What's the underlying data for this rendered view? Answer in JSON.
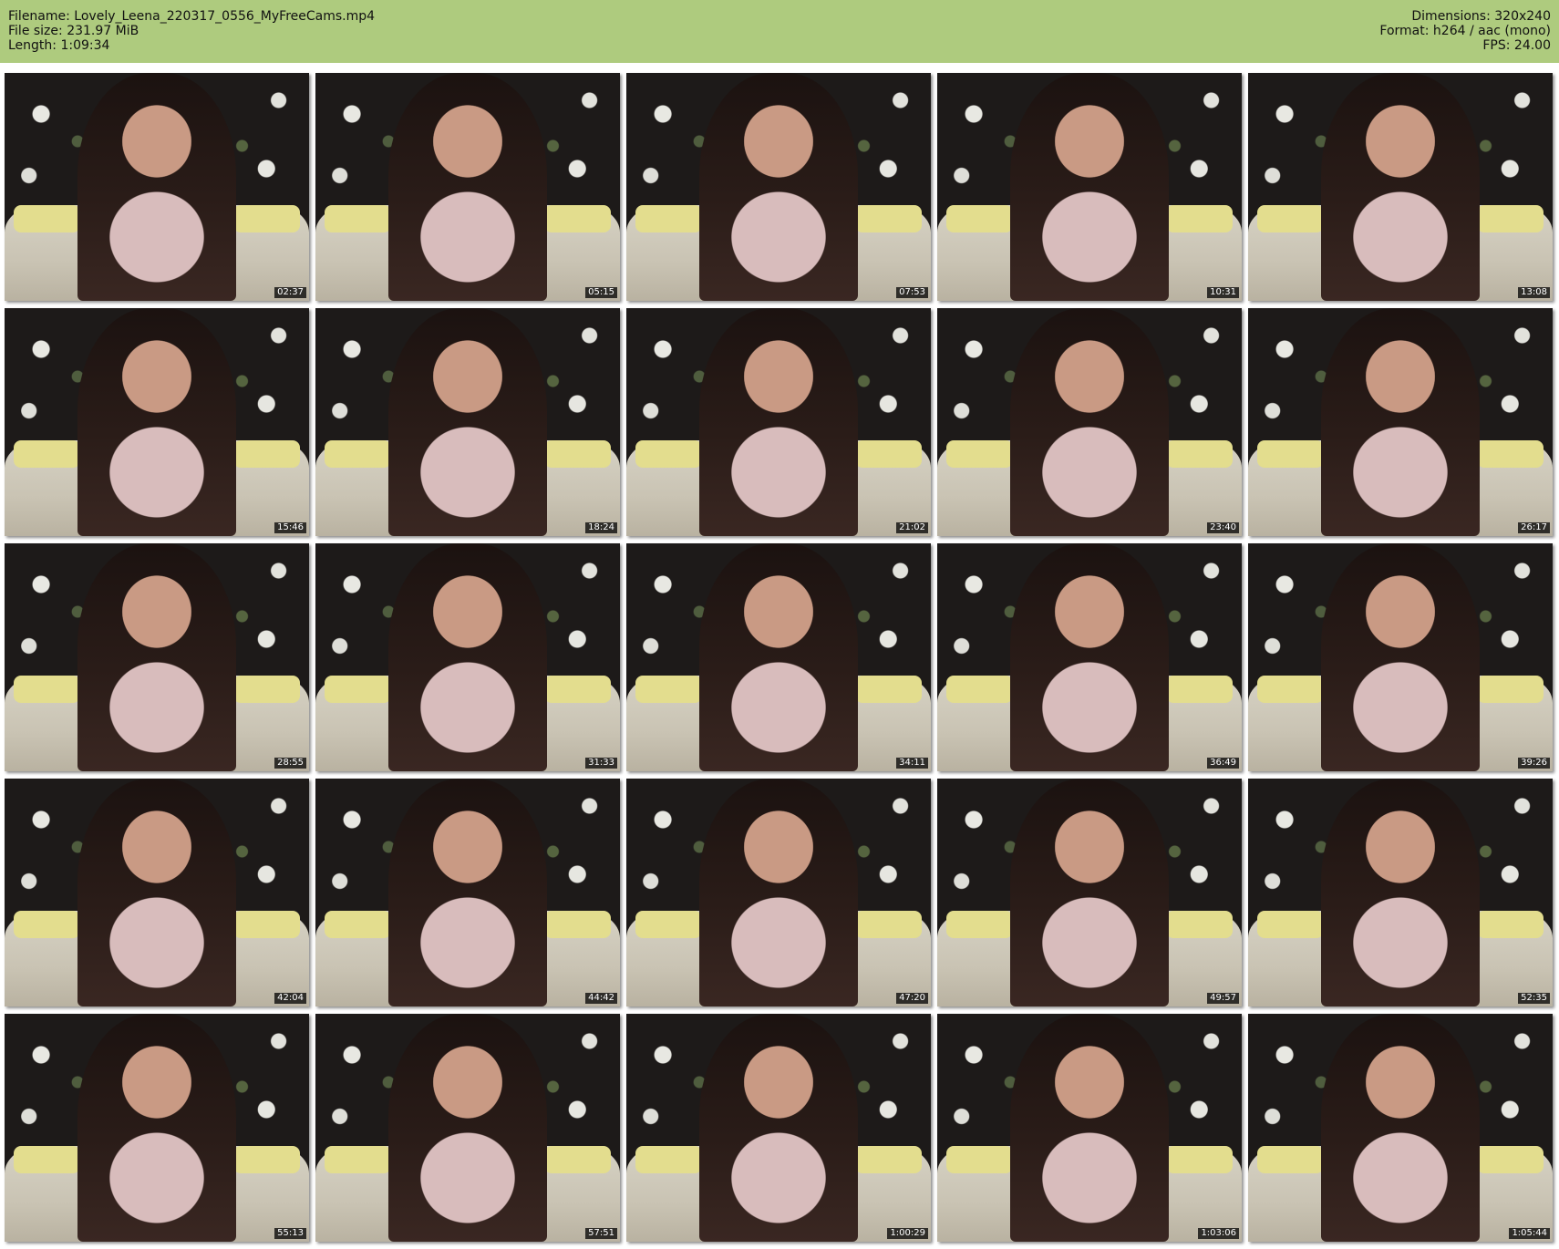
{
  "header": {
    "filename_line": "Filename: Lovely_Leena_220317_0556_MyFreeCams.mp4",
    "filesize_line": "File size: 231.97 MiB",
    "length_line": "Length: 1:09:34",
    "dimensions_line": "Dimensions: 320x240",
    "format_line": "Format: h264 / aac (mono)",
    "fps_line": "FPS: 24.00"
  },
  "colors": {
    "header_background": "#aecb7e",
    "page_background": "#ffffff",
    "timestamp_background": "#000000",
    "timestamp_text": "#ffffff"
  },
  "thumbnails": [
    {
      "timestamp": "02:37"
    },
    {
      "timestamp": "05:15"
    },
    {
      "timestamp": "07:53"
    },
    {
      "timestamp": "10:31"
    },
    {
      "timestamp": "13:08"
    },
    {
      "timestamp": "15:46"
    },
    {
      "timestamp": "18:24"
    },
    {
      "timestamp": "21:02"
    },
    {
      "timestamp": "23:40"
    },
    {
      "timestamp": "26:17"
    },
    {
      "timestamp": "28:55"
    },
    {
      "timestamp": "31:33"
    },
    {
      "timestamp": "34:11"
    },
    {
      "timestamp": "36:49"
    },
    {
      "timestamp": "39:26"
    },
    {
      "timestamp": "42:04"
    },
    {
      "timestamp": "44:42"
    },
    {
      "timestamp": "47:20"
    },
    {
      "timestamp": "49:57"
    },
    {
      "timestamp": "52:35"
    },
    {
      "timestamp": "55:13"
    },
    {
      "timestamp": "57:51"
    },
    {
      "timestamp": "1:00:29"
    },
    {
      "timestamp": "1:03:06"
    },
    {
      "timestamp": "1:05:44"
    }
  ]
}
